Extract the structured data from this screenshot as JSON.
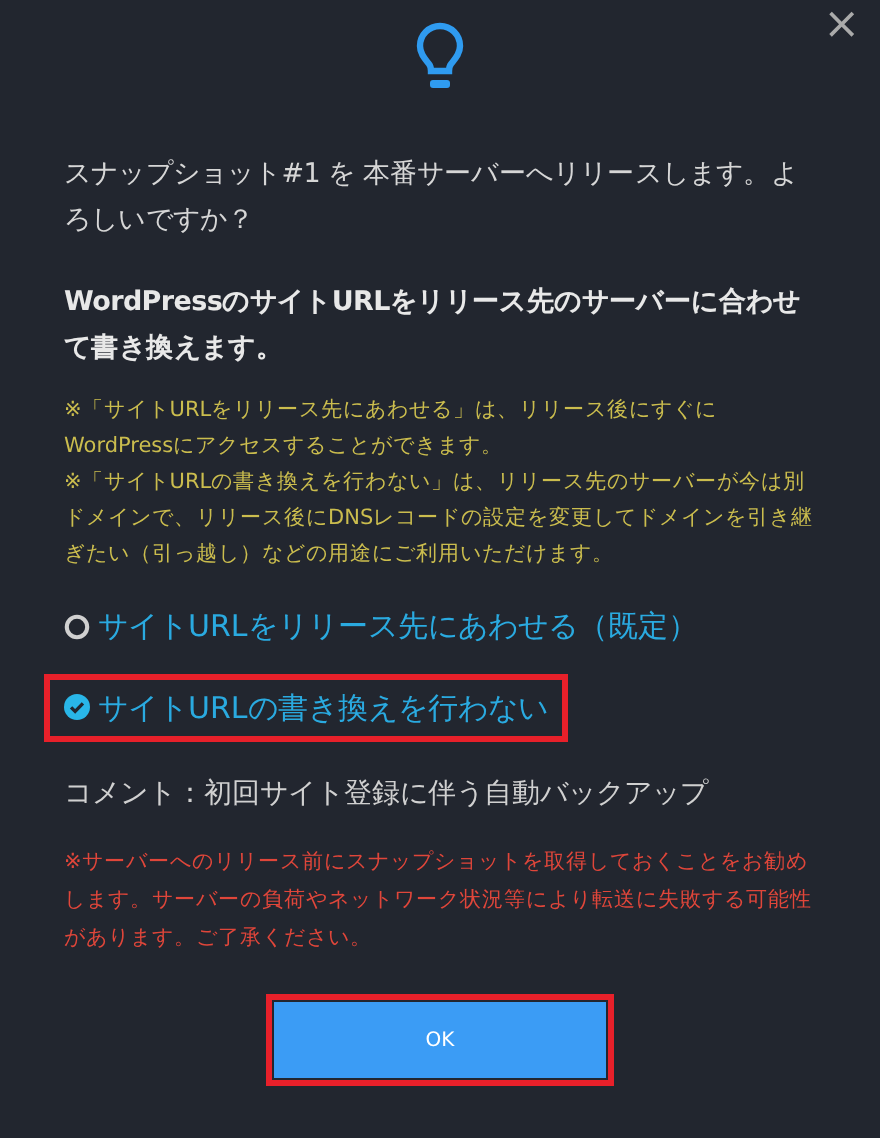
{
  "close": "×",
  "message": "スナップショット#1 を 本番サーバーへリリースします。よろしいですか？",
  "heading": "WordPressのサイトURLをリリース先のサーバーに合わせて書き換えます。",
  "notes": [
    "※「サイトURLをリリース先にあわせる」は、リリース後にすぐにWordPressにアクセスすることができます。",
    "※「サイトURLの書き換えを行わない」は、リリース先のサーバーが今は別ドメインで、リリース後にDNSレコードの設定を変更してドメインを引き継ぎたい（引っ越し）などの用途にご利用いただけます。"
  ],
  "options": [
    {
      "label": "サイトURLをリリース先にあわせる（既定）",
      "selected": false,
      "highlighted": false
    },
    {
      "label": "サイトURLの書き換えを行わない",
      "selected": true,
      "highlighted": true
    }
  ],
  "comment": "コメント：初回サイト登録に伴う自動バックアップ",
  "warning": "※サーバーへのリリース前にスナップショットを取得しておくことをお勧めします。サーバーの負荷やネットワーク状況等により転送に失敗する可能性があります。ご了承ください。",
  "ok_button": {
    "label": "OK",
    "highlighted": true
  }
}
